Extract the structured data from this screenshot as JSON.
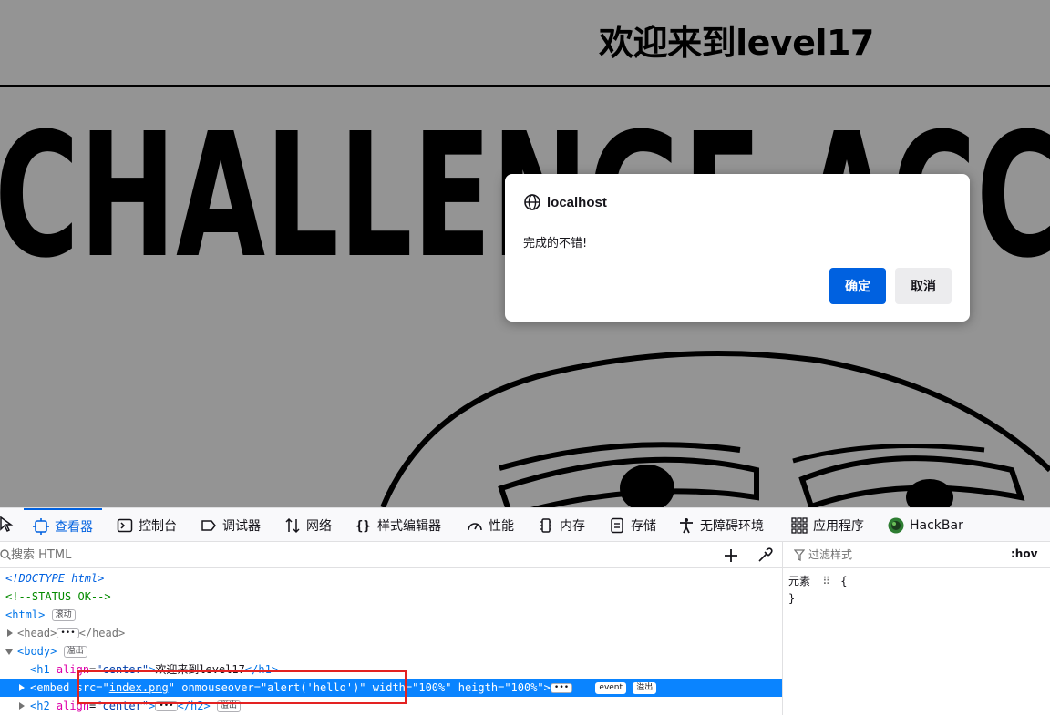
{
  "page": {
    "heading": "欢迎来到level17",
    "embed_image_text": "CHALLENGE ACC"
  },
  "dialog": {
    "origin": "localhost",
    "message": "完成的不错!",
    "ok_label": "确定",
    "cancel_label": "取消"
  },
  "devtools": {
    "tabs": [
      {
        "label": "查看器",
        "icon": "inspector-icon",
        "active": true
      },
      {
        "label": "控制台",
        "icon": "console-icon"
      },
      {
        "label": "调试器",
        "icon": "debugger-icon"
      },
      {
        "label": "网络",
        "icon": "network-icon"
      },
      {
        "label": "样式编辑器",
        "icon": "style-editor-icon"
      },
      {
        "label": "性能",
        "icon": "performance-icon"
      },
      {
        "label": "内存",
        "icon": "memory-icon"
      },
      {
        "label": "存储",
        "icon": "storage-icon"
      },
      {
        "label": "无障碍环境",
        "icon": "accessibility-icon"
      },
      {
        "label": "应用程序",
        "icon": "application-icon"
      },
      {
        "label": "HackBar",
        "icon": "hackbar-icon"
      }
    ],
    "search_placeholder": "搜索 HTML",
    "markup": {
      "doctype": "<!DOCTYPE html>",
      "comment": "<!--STATUS OK-->",
      "html_open": "<html>",
      "html_badge": "滚动",
      "head": {
        "open": "<head>",
        "close": "</head>"
      },
      "body_open": "<body>",
      "body_badge": "溢出",
      "h1": {
        "tag_open": "<h1",
        "attr": "align",
        "value": "\"center\"",
        "text": "欢迎来到level17",
        "tag_close": "</h1>"
      },
      "embed": {
        "tag_open": "<embed",
        "src_attr": "src",
        "src_value": "index.png",
        "onmouseover_attr": "onmouseover",
        "onmouseover_value": "\"alert('hello')\"",
        "width_attr": "width",
        "width_value": "\"100%\"",
        "heigth_attr": "heigth",
        "heigth_value": "\"100%\"",
        "event_badge": "event",
        "overflow_badge": "溢出"
      },
      "h2": {
        "tag_open": "<h2",
        "attr": "align",
        "value": "\"center\"",
        "tag_close": "</h2>",
        "badge": "溢出"
      }
    },
    "rules": {
      "filter_placeholder": "过滤样式",
      "hov_label": ":hov",
      "element_label": "元素",
      "open_brace": "{",
      "close_brace": "}"
    }
  },
  "colors": {
    "accent": "#0061e0",
    "selection": "#0a84ff",
    "highlight_box": "#e32222"
  }
}
